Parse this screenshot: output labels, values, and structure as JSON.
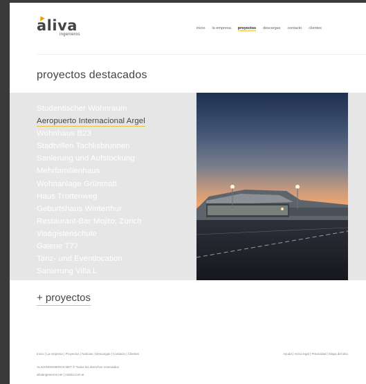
{
  "logo": {
    "name": "aliva",
    "sub": "ingenieros"
  },
  "nav": {
    "items": [
      {
        "label": "inicio"
      },
      {
        "label": "la empresa"
      },
      {
        "label": "proyectos",
        "active": true
      },
      {
        "label": "descargas"
      },
      {
        "label": "contacto"
      },
      {
        "label": "clientes"
      }
    ]
  },
  "section_title": "proyectos destacados",
  "projects": [
    {
      "label": "Studentischer Wohnraum"
    },
    {
      "label": "Aeropuerto Internacional Argel",
      "active": true
    },
    {
      "label": "Wohnhaus B23"
    },
    {
      "label": "Stadtvillen Tachlisbrunnen"
    },
    {
      "label": "Sanierung und Aufstockung"
    },
    {
      "label": "Mehrfamilienhaus"
    },
    {
      "label": "Wohnanlage Grünmatt"
    },
    {
      "label": "Haus Trottenweg"
    },
    {
      "label": "Geburtshaus Winterthur"
    },
    {
      "label": "Restaurant-Bar Mojito, Zürich"
    },
    {
      "label": "Visagistenschule"
    },
    {
      "label": "Galerie T77"
    },
    {
      "label": "Tanz- und Eventlocation"
    },
    {
      "label": "Sanierung Villa L"
    }
  ],
  "more_label": "+ proyectos",
  "footer": {
    "left": "Inicio | La empresa | Proyectos | Noticias | Descargas | Contacto | Clientes",
    "right": "Ayuda | Aviso legal | Privacidad | Mapa del sitio",
    "copyright": "ALIVAINGENIEROS.NET  © Todos los derechos reservados",
    "links": "alivaingenieros.net | matria.com.ar"
  },
  "colors": {
    "accent": "#f0c040",
    "band": "#e6e6e6",
    "text": "#444444"
  }
}
